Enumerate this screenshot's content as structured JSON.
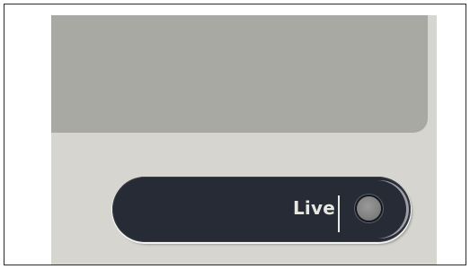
{
  "live_button": {
    "label": "Live",
    "state": "off",
    "indicator_icon": "led-indicator-icon"
  },
  "colors": {
    "panel_background": "#d6d5cf",
    "display_area": "#a9a9a3",
    "button_background": "#262b36",
    "button_text": "#e7e7e2",
    "indicator_off": "#808080"
  }
}
